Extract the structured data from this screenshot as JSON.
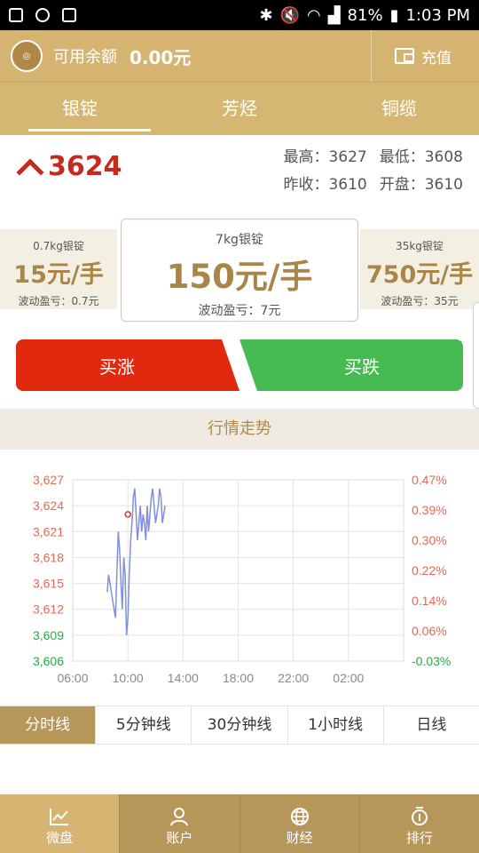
{
  "status_bar": {
    "battery": "81%",
    "time": "1:03 PM"
  },
  "balance": {
    "label": "可用余额",
    "value": "0.00元",
    "recharge": "充值"
  },
  "tabs": [
    {
      "label": "银锭",
      "active": true
    },
    {
      "label": "芳烃",
      "active": false
    },
    {
      "label": "铜缆",
      "active": false
    }
  ],
  "quote": {
    "current": "3624",
    "high_label": "最高：",
    "high": "3627",
    "low_label": "最低：",
    "low": "3608",
    "prev_close_label": "昨收：",
    "prev_close": "3610",
    "open_label": "开盘：",
    "open": "3610"
  },
  "products": [
    {
      "name": "0.7kg银锭",
      "price": "15元/手",
      "wave": "波动盈亏：0.7元"
    },
    {
      "name": "7kg银锭",
      "price": "150元/手",
      "wave": "波动盈亏：7元"
    },
    {
      "name": "35kg银锭",
      "price": "750元/手",
      "wave": "波动盈亏：35元"
    }
  ],
  "actions": {
    "buy_up": "买涨",
    "buy_down": "买跌"
  },
  "trend_title": "行情走势",
  "chart_data": {
    "type": "line",
    "y_left_ticks": [
      "3,627",
      "3,624",
      "3,621",
      "3,618",
      "3,615",
      "3,612",
      "3,609",
      "3,606"
    ],
    "y_right_ticks": [
      "0.47%",
      "0.39%",
      "0.30%",
      "0.22%",
      "0.14%",
      "0.06%",
      "-0.03%"
    ],
    "x_ticks": [
      "06:00",
      "10:00",
      "14:00",
      "18:00",
      "22:00",
      "02:00"
    ],
    "ylim": [
      3606,
      3627
    ],
    "prev_close": 3610,
    "series_color": "#8090d8",
    "marker": {
      "x": 10.0,
      "y": 3623
    },
    "x": [
      8.5,
      8.6,
      8.7,
      8.8,
      8.9,
      9.0,
      9.1,
      9.2,
      9.3,
      9.4,
      9.5,
      9.6,
      9.7,
      9.8,
      9.9,
      10.0,
      10.1,
      10.2,
      10.3,
      10.4,
      10.5,
      10.6,
      10.7,
      10.8,
      10.9,
      11.0,
      11.1,
      11.2,
      11.3,
      11.4,
      11.5,
      11.6,
      11.7,
      11.8,
      11.9,
      12.0,
      12.1,
      12.2,
      12.3,
      12.4,
      12.5,
      12.6,
      12.7
    ],
    "y": [
      3614,
      3616,
      3615,
      3614,
      3613,
      3612,
      3611,
      3616,
      3621,
      3619,
      3615,
      3612,
      3618,
      3616,
      3609,
      3611,
      3616,
      3620,
      3622,
      3625,
      3626,
      3623,
      3620,
      3622,
      3624,
      3621,
      3623,
      3622,
      3620,
      3624,
      3621,
      3623,
      3625,
      3626,
      3624,
      3622,
      3623,
      3624,
      3626,
      3625,
      3622,
      3623,
      3624
    ]
  },
  "intervals": [
    {
      "label": "分时线",
      "active": true
    },
    {
      "label": "5分钟线",
      "active": false
    },
    {
      "label": "30分钟线",
      "active": false
    },
    {
      "label": "1小时线",
      "active": false
    },
    {
      "label": "日线",
      "active": false
    }
  ],
  "bottom_nav": [
    {
      "label": "微盘",
      "icon": "chart-icon",
      "active": true
    },
    {
      "label": "账户",
      "icon": "user-icon",
      "active": false
    },
    {
      "label": "财经",
      "icon": "globe-icon",
      "active": false
    },
    {
      "label": "排行",
      "icon": "medal-icon",
      "active": false
    }
  ]
}
